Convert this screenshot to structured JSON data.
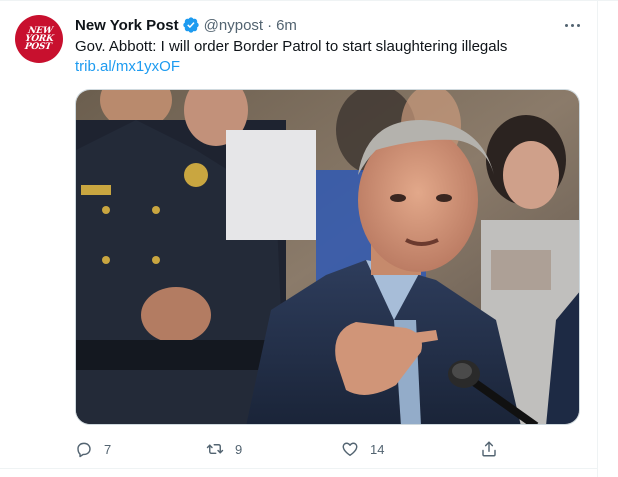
{
  "tweet": {
    "author_name": "New York Post",
    "verified": true,
    "handle": "@nypost",
    "separator": "·",
    "time": "6m",
    "text": "Gov. Abbott: I will order Border Patrol to start slaughtering illegals",
    "link": "trib.al/mx1yxOF",
    "avatar_text": [
      "NEW",
      "YORK",
      "POST"
    ],
    "media_icon": "photo"
  },
  "actions": {
    "reply_count": "7",
    "retweet_count": "9",
    "like_count": "14",
    "reply_icon": "reply-icon",
    "retweet_icon": "retweet-icon",
    "like_icon": "heart-icon",
    "share_icon": "share-icon"
  },
  "colors": {
    "brand_red": "#c8102e",
    "link_blue": "#1d9bf0",
    "muted": "#536471",
    "text": "#0f1419"
  }
}
